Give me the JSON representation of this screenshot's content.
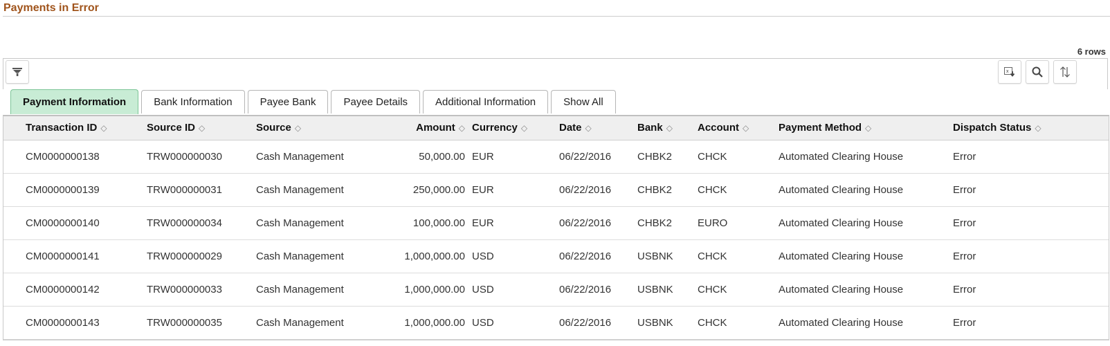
{
  "page": {
    "title": "Payments in Error",
    "row_count": "6 rows"
  },
  "toolbar": {
    "filter_icon": "filter-icon",
    "export_icon": "export-excel-icon",
    "search_icon": "search-icon",
    "sort_icon": "sort-icon"
  },
  "tabs": [
    {
      "label": "Payment Information",
      "active": true
    },
    {
      "label": "Bank Information",
      "active": false
    },
    {
      "label": "Payee Bank",
      "active": false
    },
    {
      "label": "Payee Details",
      "active": false
    },
    {
      "label": "Additional Information",
      "active": false
    },
    {
      "label": "Show All",
      "active": false
    }
  ],
  "table": {
    "sort_glyph": "◇",
    "columns": [
      "Transaction ID",
      "Source ID",
      "Source",
      "Amount",
      "Currency",
      "Date",
      "Bank",
      "Account",
      "Payment Method",
      "Dispatch Status"
    ],
    "rows": [
      [
        "CM0000000138",
        "TRW000000030",
        "Cash Management",
        "50,000.00",
        "EUR",
        "06/22/2016",
        "CHBK2",
        "CHCK",
        "Automated Clearing House",
        "Error"
      ],
      [
        "CM0000000139",
        "TRW000000031",
        "Cash Management",
        "250,000.00",
        "EUR",
        "06/22/2016",
        "CHBK2",
        "CHCK",
        "Automated Clearing House",
        "Error"
      ],
      [
        "CM0000000140",
        "TRW000000034",
        "Cash Management",
        "100,000.00",
        "EUR",
        "06/22/2016",
        "CHBK2",
        "EURO",
        "Automated Clearing House",
        "Error"
      ],
      [
        "CM0000000141",
        "TRW000000029",
        "Cash Management",
        "1,000,000.00",
        "USD",
        "06/22/2016",
        "USBNK",
        "CHCK",
        "Automated Clearing House",
        "Error"
      ],
      [
        "CM0000000142",
        "TRW000000033",
        "Cash Management",
        "1,000,000.00",
        "USD",
        "06/22/2016",
        "USBNK",
        "CHCK",
        "Automated Clearing House",
        "Error"
      ],
      [
        "CM0000000143",
        "TRW000000035",
        "Cash Management",
        "1,000,000.00",
        "USD",
        "06/22/2016",
        "USBNK",
        "CHCK",
        "Automated Clearing House",
        "Error"
      ]
    ]
  },
  "colors": {
    "title": "#a0541c",
    "active_tab": "#c8ecd5",
    "header_bg": "#efefef"
  }
}
